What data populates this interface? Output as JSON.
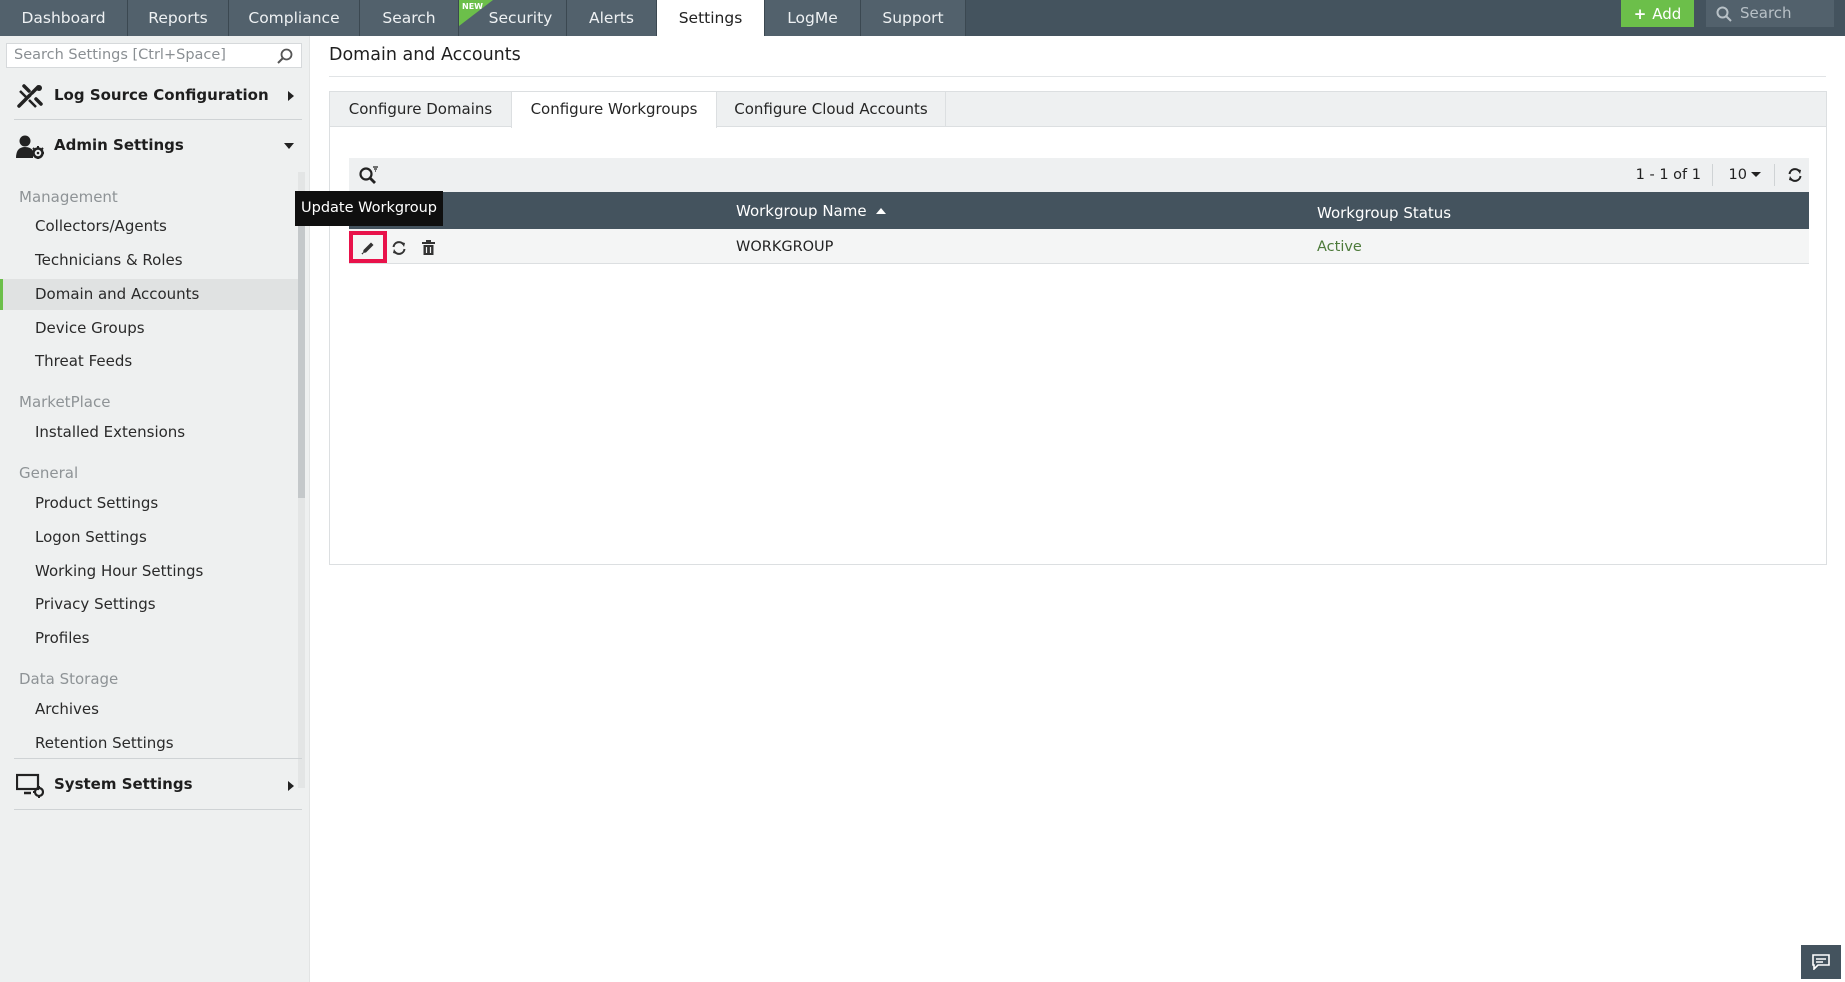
{
  "topnav": {
    "tabs": [
      {
        "label": "Dashboard"
      },
      {
        "label": "Reports"
      },
      {
        "label": "Compliance"
      },
      {
        "label": "Search"
      },
      {
        "label": "Security",
        "badge": "NEW"
      },
      {
        "label": "Alerts"
      },
      {
        "label": "Settings",
        "active": true
      },
      {
        "label": "LogMe"
      },
      {
        "label": "Support"
      }
    ],
    "add_label": "Add",
    "search_placeholder": "Search"
  },
  "sidebar": {
    "search_placeholder": "Search Settings [Ctrl+Space]",
    "sections": {
      "log_source": "Log Source Configuration",
      "admin": "Admin Settings",
      "system": "System Settings"
    },
    "groups": {
      "management": "Management",
      "marketplace": "MarketPlace",
      "general": "General",
      "data_storage": "Data Storage"
    },
    "items": {
      "collectors": "Collectors/Agents",
      "technicians": "Technicians & Roles",
      "domain_accounts": "Domain and Accounts",
      "device_groups": "Device Groups",
      "threat_feeds": "Threat Feeds",
      "installed_extensions": "Installed Extensions",
      "product_settings": "Product Settings",
      "logon_settings": "Logon Settings",
      "working_hour": "Working Hour Settings",
      "privacy": "Privacy Settings",
      "profiles": "Profiles",
      "archives": "Archives",
      "retention": "Retention Settings"
    },
    "active_item": "Domain and Accounts"
  },
  "main": {
    "title": "Domain and Accounts",
    "subtabs": [
      {
        "label": "Configure Domains"
      },
      {
        "label": "Configure Workgroups",
        "active": true
      },
      {
        "label": "Configure Cloud Accounts"
      }
    ],
    "pager": {
      "range": "1 - 1 of 1",
      "page_size": "10"
    },
    "table": {
      "columns": [
        "Workgroup Name",
        "Workgroup Status"
      ],
      "sorted_column": "Workgroup Name",
      "sort_direction": "ascending",
      "rows": [
        {
          "name": "WORKGROUP",
          "status": "Active"
        }
      ]
    },
    "tooltip": "Update Workgroup"
  },
  "colors": {
    "nav_bg": "#44535e",
    "accent_green": "#6cbf4a",
    "highlight_red": "#e8124a",
    "status_active": "#4d7a3a"
  },
  "icons": [
    "search-icon",
    "tools-icon",
    "admin-gear-icon",
    "system-settings-icon",
    "filter-search-icon",
    "refresh-icon",
    "edit-icon",
    "sync-icon",
    "delete-icon",
    "chat-icon"
  ]
}
